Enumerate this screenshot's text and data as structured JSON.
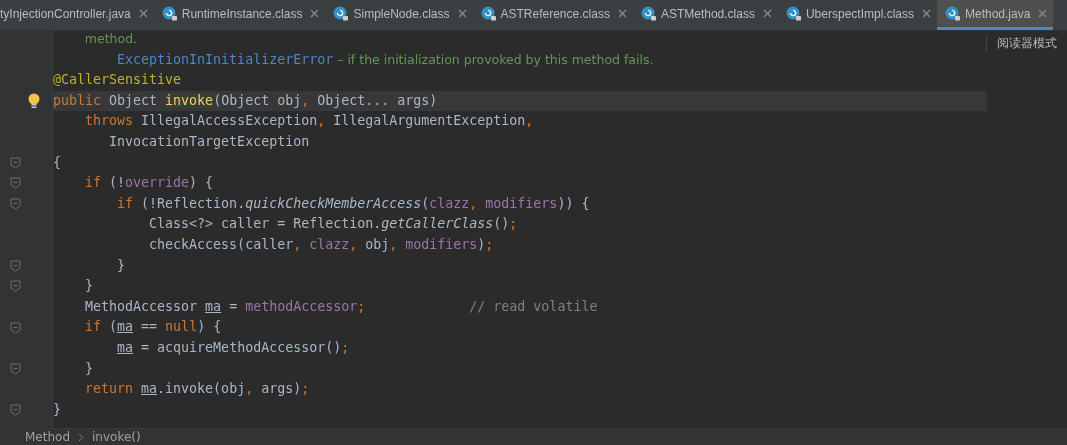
{
  "tabs": [
    {
      "label": "tyInjectionController.java",
      "has_icon": false,
      "selected": false
    },
    {
      "label": "RuntimeInstance.class",
      "has_icon": true,
      "selected": false
    },
    {
      "label": "SimpleNode.class",
      "has_icon": true,
      "selected": false
    },
    {
      "label": "ASTReference.class",
      "has_icon": true,
      "selected": false
    },
    {
      "label": "ASTMethod.class",
      "has_icon": true,
      "selected": false
    },
    {
      "label": "UberspectImpl.class",
      "has_icon": true,
      "selected": false
    },
    {
      "label": "Method.java",
      "has_icon": true,
      "selected": true
    }
  ],
  "reader_mode": "阅读器模式",
  "code_lines": [
    {
      "fold_marker": false,
      "current": false,
      "bulb": false,
      "tokens": [
        {
          "kind": "doc",
          "text": "        method."
        }
      ]
    },
    {
      "fold_marker": false,
      "current": false,
      "bulb": false,
      "tokens": [
        {
          "kind": "doclink",
          "text": "        ExceptionInInitializerError"
        },
        {
          "kind": "doc",
          "text": " – if the initialization provoked by this method fails."
        }
      ]
    },
    {
      "fold_marker": false,
      "current": false,
      "bulb": false,
      "tokens": [
        {
          "kind": "ann",
          "text": "@CallerSensitive"
        }
      ]
    },
    {
      "fold_marker": false,
      "current": true,
      "bulb": true,
      "tokens": [
        {
          "kind": "kw",
          "text": "public "
        },
        {
          "kind": "plain",
          "text": "Object "
        },
        {
          "kind": "decl",
          "text": "invoke"
        },
        {
          "kind": "plain",
          "text": "(Object obj"
        },
        {
          "kind": "kw",
          "text": ", "
        },
        {
          "kind": "plain",
          "text": "Object... args)"
        }
      ]
    },
    {
      "fold_marker": false,
      "current": false,
      "bulb": false,
      "tokens": [
        {
          "kind": "kw",
          "text": "    throws "
        },
        {
          "kind": "plain",
          "text": "IllegalAccessException"
        },
        {
          "kind": "kw",
          "text": ", "
        },
        {
          "kind": "plain",
          "text": "IllegalArgumentException"
        },
        {
          "kind": "kw",
          "text": ","
        }
      ]
    },
    {
      "fold_marker": false,
      "current": false,
      "bulb": false,
      "tokens": [
        {
          "kind": "plain",
          "text": "       InvocationTargetException"
        }
      ]
    },
    {
      "fold_marker": true,
      "current": false,
      "bulb": false,
      "tokens": [
        {
          "kind": "plain",
          "text": "{"
        }
      ]
    },
    {
      "fold_marker": true,
      "current": false,
      "bulb": false,
      "tokens": [
        {
          "kind": "kw",
          "text": "    if "
        },
        {
          "kind": "plain",
          "text": "(!"
        },
        {
          "kind": "field",
          "text": "override"
        },
        {
          "kind": "plain",
          "text": ") {"
        }
      ]
    },
    {
      "fold_marker": true,
      "current": false,
      "bulb": false,
      "tokens": [
        {
          "kind": "kw",
          "text": "        if "
        },
        {
          "kind": "plain",
          "text": "(!Reflection."
        },
        {
          "kind": "static",
          "text": "quickCheckMemberAccess"
        },
        {
          "kind": "plain",
          "text": "("
        },
        {
          "kind": "field",
          "text": "clazz"
        },
        {
          "kind": "kw",
          "text": ", "
        },
        {
          "kind": "field",
          "text": "modifiers"
        },
        {
          "kind": "plain",
          "text": ")) {"
        }
      ]
    },
    {
      "fold_marker": false,
      "current": false,
      "bulb": false,
      "tokens": [
        {
          "kind": "plain",
          "text": "            Class<?> caller = Reflection."
        },
        {
          "kind": "static",
          "text": "getCallerClass"
        },
        {
          "kind": "plain",
          "text": "()"
        },
        {
          "kind": "kw",
          "text": ";"
        }
      ]
    },
    {
      "fold_marker": false,
      "current": false,
      "bulb": false,
      "tokens": [
        {
          "kind": "plain",
          "text": "            checkAccess(caller"
        },
        {
          "kind": "kw",
          "text": ", "
        },
        {
          "kind": "field",
          "text": "clazz"
        },
        {
          "kind": "kw",
          "text": ", "
        },
        {
          "kind": "plain",
          "text": "obj"
        },
        {
          "kind": "kw",
          "text": ", "
        },
        {
          "kind": "field",
          "text": "modifiers"
        },
        {
          "kind": "plain",
          "text": ")"
        },
        {
          "kind": "kw",
          "text": ";"
        }
      ]
    },
    {
      "fold_marker": true,
      "current": false,
      "bulb": false,
      "tokens": [
        {
          "kind": "plain",
          "text": "        }"
        }
      ]
    },
    {
      "fold_marker": true,
      "current": false,
      "bulb": false,
      "tokens": [
        {
          "kind": "plain",
          "text": "    }"
        }
      ]
    },
    {
      "fold_marker": false,
      "current": false,
      "bulb": false,
      "tokens": [
        {
          "kind": "plain",
          "text": "    MethodAccessor "
        },
        {
          "kind": "local",
          "text": "ma"
        },
        {
          "kind": "plain",
          "text": " = "
        },
        {
          "kind": "field",
          "text": "methodAccessor"
        },
        {
          "kind": "kw",
          "text": ";"
        },
        {
          "kind": "comment",
          "text": "             // read volatile"
        }
      ]
    },
    {
      "fold_marker": true,
      "current": false,
      "bulb": false,
      "tokens": [
        {
          "kind": "kw",
          "text": "    if "
        },
        {
          "kind": "plain",
          "text": "("
        },
        {
          "kind": "local",
          "text": "ma"
        },
        {
          "kind": "plain",
          "text": " == "
        },
        {
          "kind": "kw",
          "text": "null"
        },
        {
          "kind": "plain",
          "text": ") {"
        }
      ]
    },
    {
      "fold_marker": false,
      "current": false,
      "bulb": false,
      "tokens": [
        {
          "kind": "local",
          "text": "        ma"
        },
        {
          "kind": "plain",
          "text": " = acquireMethodAccessor()"
        },
        {
          "kind": "kw",
          "text": ";"
        }
      ]
    },
    {
      "fold_marker": true,
      "current": false,
      "bulb": false,
      "tokens": [
        {
          "kind": "plain",
          "text": "    }"
        }
      ]
    },
    {
      "fold_marker": false,
      "current": false,
      "bulb": false,
      "tokens": [
        {
          "kind": "kw",
          "text": "    return "
        },
        {
          "kind": "local",
          "text": "ma"
        },
        {
          "kind": "plain",
          "text": ".invoke(obj"
        },
        {
          "kind": "kw",
          "text": ", "
        },
        {
          "kind": "plain",
          "text": "args)"
        },
        {
          "kind": "kw",
          "text": ";"
        }
      ]
    },
    {
      "fold_marker": true,
      "current": false,
      "bulb": false,
      "tokens": [
        {
          "kind": "plain",
          "text": "}"
        }
      ]
    }
  ],
  "breadcrumbs": [
    "Method",
    "invoke()"
  ]
}
